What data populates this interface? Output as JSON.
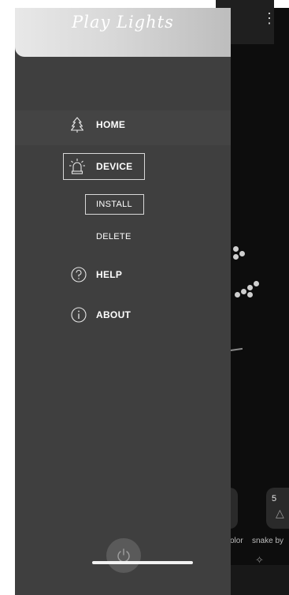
{
  "drawer": {
    "title": "Play Lights",
    "nav": {
      "home": "HOME",
      "device": "DEVICE",
      "help": "HELP",
      "about": "ABOUT"
    },
    "device_sub": {
      "install": "INSTALL",
      "delete": "DELETE"
    },
    "icons": {
      "home": "tree-icon",
      "device": "siren-icon",
      "help": "help-circle-icon",
      "about": "info-circle-icon",
      "power": "power-icon"
    }
  },
  "background_app": {
    "overflow_glyph": "⋮",
    "thumb_5_number": "5",
    "label_color": "olor",
    "label_snake": "snake by"
  },
  "colors": {
    "drawer_bg": "#3f3f3f",
    "header_gradient_start": "#e8e8e8",
    "app_bg": "#0d0d0d"
  }
}
